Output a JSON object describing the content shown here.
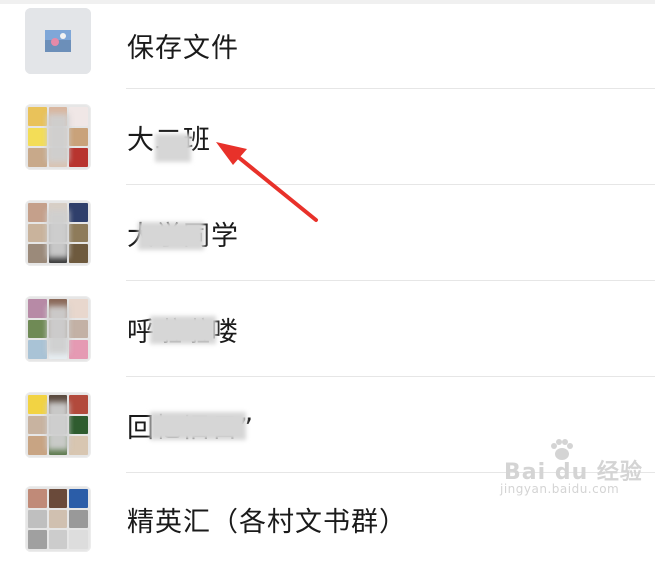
{
  "chat_list": [
    {
      "name": "保存文件",
      "avatar_icon": "image-thumbnail-icon"
    },
    {
      "name": "大二班",
      "avatar_icon": "group-avatar-icon"
    },
    {
      "name": "大学同学",
      "avatar_icon": "group-avatar-icon"
    },
    {
      "name": "呼啦啦喽",
      "avatar_icon": "group-avatar-icon"
    },
    {
      "name": "回忆旧日”",
      "avatar_icon": "group-avatar-icon"
    },
    {
      "name": "精英汇（各村文书群）",
      "avatar_icon": "group-avatar-icon"
    }
  ],
  "annotation": {
    "arrow_color": "#e8312a"
  },
  "watermark": {
    "brand": "Bai du 经验",
    "url": "jingyan.baidu.com"
  }
}
